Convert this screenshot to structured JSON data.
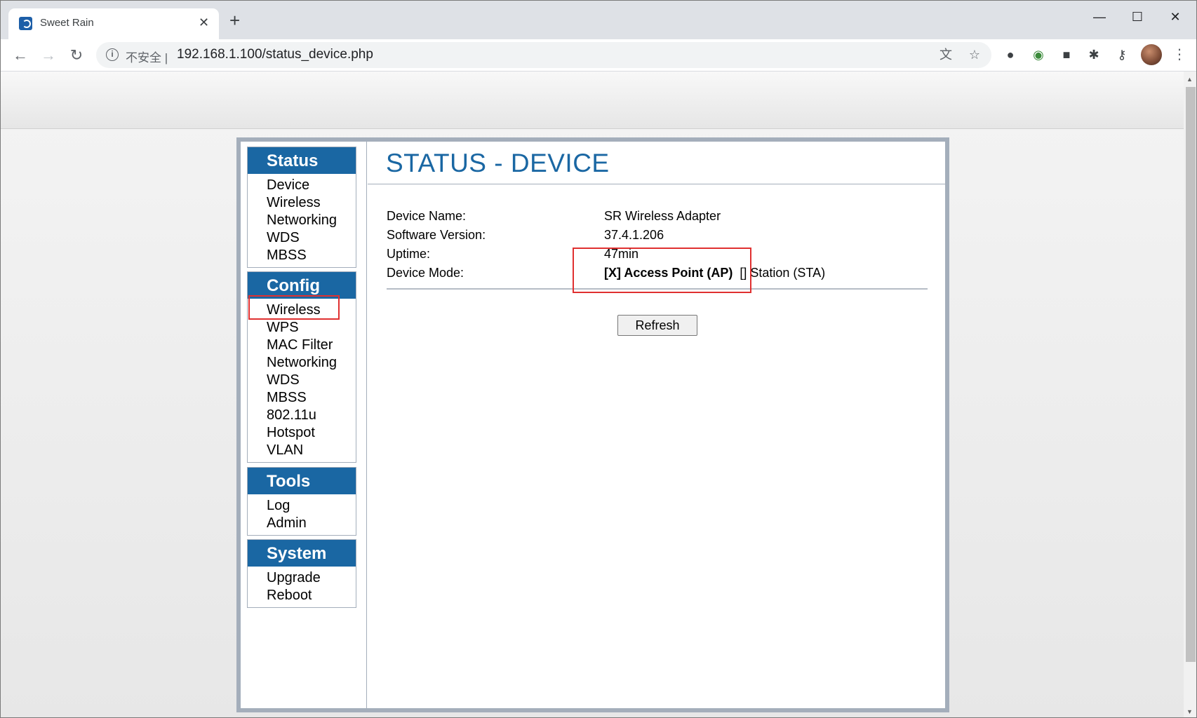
{
  "browser": {
    "tab_title": "Sweet Rain",
    "tab_close": "✕",
    "new_tab": "+",
    "insecure_label": "不安全 |",
    "url": "192.168.1.100/status_device.php"
  },
  "sidebar": {
    "status": {
      "heading": "Status",
      "items": [
        "Device",
        "Wireless",
        "Networking",
        "WDS",
        "MBSS"
      ]
    },
    "config": {
      "heading": "Config",
      "items": [
        "Wireless",
        "WPS",
        "MAC Filter",
        "Networking",
        "WDS",
        "MBSS",
        "802.11u",
        "Hotspot",
        "VLAN"
      ]
    },
    "tools": {
      "heading": "Tools",
      "items": [
        "Log",
        "Admin"
      ]
    },
    "system": {
      "heading": "System",
      "items": [
        "Upgrade",
        "Reboot"
      ]
    }
  },
  "main": {
    "title": "STATUS - DEVICE",
    "fields": [
      {
        "label": "Device Name:",
        "value": "SR Wireless Adapter"
      },
      {
        "label": "Software Version:",
        "value": "37.4.1.206"
      },
      {
        "label": "Uptime:",
        "value": "47min"
      },
      {
        "label": "Device Mode:",
        "value_selected": "[X] Access Point (AP)",
        "value_other": "[] Station (STA)"
      }
    ],
    "refresh_label": "Refresh"
  },
  "colors": {
    "accent": "#1a67a3",
    "frame_border": "#a4aebb",
    "annotation": "#e03030"
  },
  "icons": [
    "back-arrow-icon",
    "forward-arrow-icon",
    "reload-icon",
    "info-icon",
    "translate-icon",
    "star-icon",
    "extension-icon",
    "key-icon",
    "menu-dots-icon"
  ]
}
